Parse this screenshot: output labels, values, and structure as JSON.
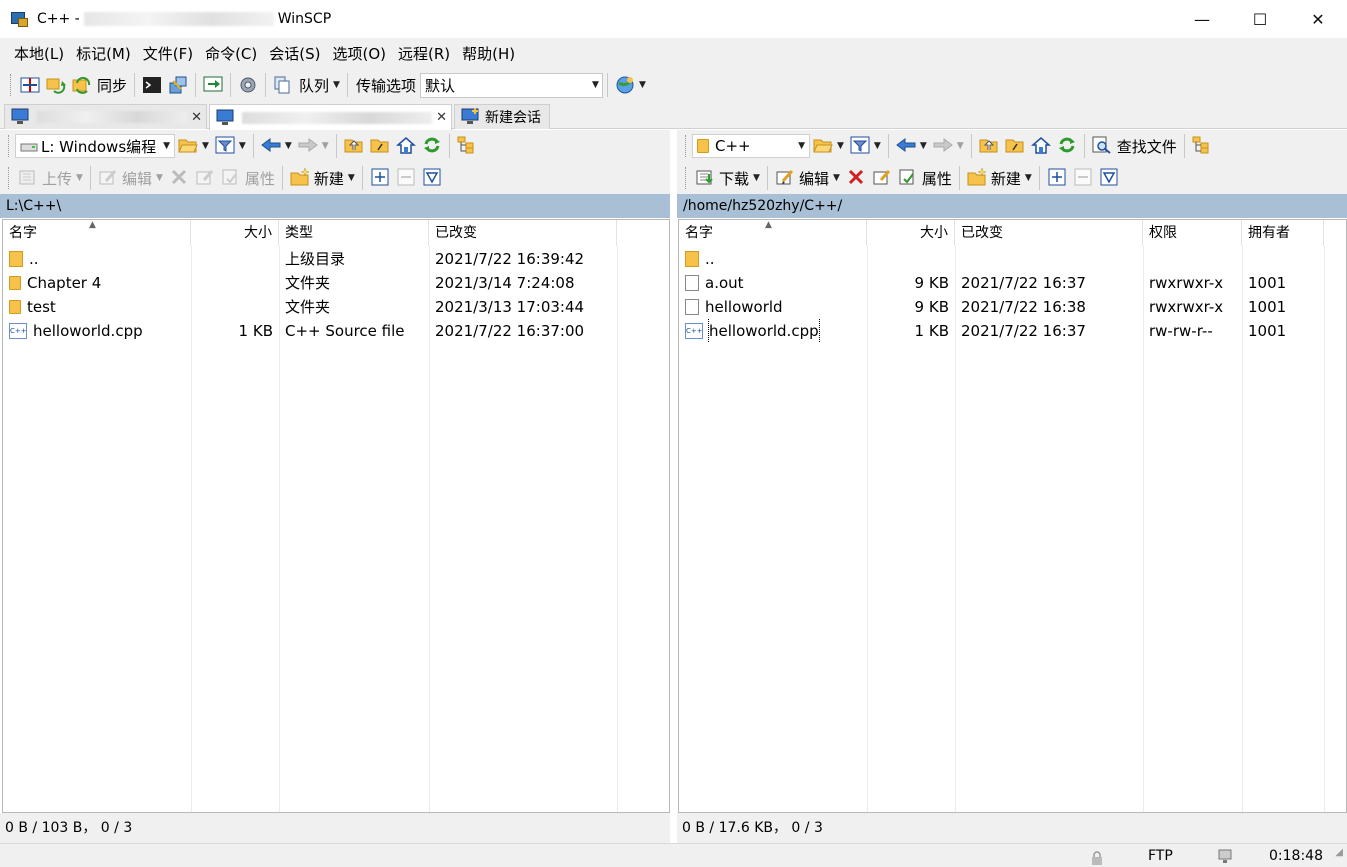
{
  "window": {
    "title_prefix": "C++ - ",
    "title_suffix": "WinSCP",
    "minimize": "—",
    "maximize": "☐",
    "close": "✕"
  },
  "menu": [
    "本地(L)",
    "标记(M)",
    "文件(F)",
    "命令(C)",
    "会话(S)",
    "选项(O)",
    "远程(R)",
    "帮助(H)"
  ],
  "toolbar": {
    "sync_label": "同步",
    "queue_label": "队列",
    "transfer_label": "传输选项",
    "transfer_value": "默认"
  },
  "session_tabs": {
    "new_session": "新建会话"
  },
  "local": {
    "location": "L: Windows编程",
    "upload": "上传",
    "edit": "编辑",
    "properties": "属性",
    "new": "新建",
    "path": "L:\\C++\\",
    "columns": [
      "名字",
      "大小",
      "类型",
      "已改变"
    ],
    "files": [
      {
        "name": "..",
        "size": "",
        "type": "上级目录",
        "changed": "2021/7/22  16:39:42",
        "icon": "parent-dir-icon"
      },
      {
        "name": "Chapter 4",
        "size": "",
        "type": "文件夹",
        "changed": "2021/3/14  7:24:08",
        "icon": "folder-icon"
      },
      {
        "name": "test",
        "size": "",
        "type": "文件夹",
        "changed": "2021/3/13  17:03:44",
        "icon": "folder-icon"
      },
      {
        "name": "helloworld.cpp",
        "size": "1 KB",
        "type": "C++ Source file",
        "changed": "2021/7/22  16:37:00",
        "icon": "cpp-file-icon"
      }
    ],
    "status": "0 B / 103 B，  0 / 3"
  },
  "remote": {
    "location": "C++",
    "download": "下载",
    "edit": "编辑",
    "properties": "属性",
    "new": "新建",
    "find": "查找文件",
    "path": "/home/hz520zhy/C++/",
    "columns": [
      "名字",
      "大小",
      "已改变",
      "权限",
      "拥有者"
    ],
    "files": [
      {
        "name": "..",
        "size": "",
        "changed": "",
        "rights": "",
        "owner": "",
        "icon": "parent-dir-icon"
      },
      {
        "name": "a.out",
        "size": "9 KB",
        "changed": "2021/7/22 16:37",
        "rights": "rwxrwxr-x",
        "owner": "1001",
        "icon": "file-icon"
      },
      {
        "name": "helloworld",
        "size": "9 KB",
        "changed": "2021/7/22 16:38",
        "rights": "rwxrwxr-x",
        "owner": "1001",
        "icon": "file-icon"
      },
      {
        "name": "helloworld.cpp",
        "size": "1 KB",
        "changed": "2021/7/22 16:37",
        "rights": "rw-rw-r--",
        "owner": "1001",
        "icon": "cpp-file-icon"
      }
    ],
    "status": "0 B / 17.6 KB，  0 / 3"
  },
  "statusbar": {
    "protocol": "FTP",
    "elapsed": "0:18:48"
  }
}
